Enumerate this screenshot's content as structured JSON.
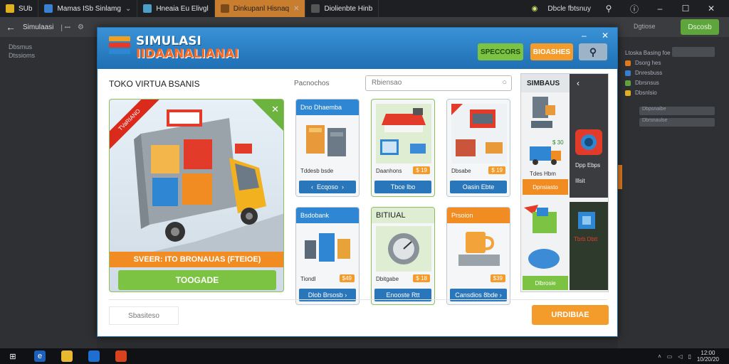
{
  "browser": {
    "tabs": [
      {
        "label": "SUb",
        "color": "#e0b020"
      },
      {
        "label": "Mamas ISb Sinlamg",
        "color": "#3b7fd1"
      },
      {
        "label": "Hneaia Eu Elivgl",
        "color": "#4aa0c8"
      },
      {
        "label": "Dinkupanl Hisnaq",
        "color": "#d28a2a"
      },
      {
        "label": "Diolienbte Hinb",
        "color": "#888888"
      }
    ],
    "right_label": "Dbcle fbtsnuy",
    "toolbar_title": "Simulaasi",
    "toolbar_btn": "Dscosb",
    "toolbar_side": "Dgtiose"
  },
  "left_panel": {
    "line1": "Dbsmus",
    "line2": "Dtssioms"
  },
  "right_panel": {
    "header": "Ltoska Basing foe",
    "rows": [
      "Dsorg hes",
      "Dnresbuss",
      "Dbrsnsus",
      "Dbsnlsio"
    ],
    "bars": [
      "Dbpsnaibe",
      "Dbrsnaulse"
    ]
  },
  "app": {
    "title_line1": "SIMULASI",
    "title_line2": "IIDAANALIANAI",
    "btn_green": "SPECCORS",
    "btn_orange": "BIOASHES",
    "store_name": "TOKO VIRTUA BSANIS",
    "products_label": "Pacnochos",
    "search_placeholder": "Rbiensao",
    "hero": {
      "ribbon": "TVaRIANO",
      "strip": "SVEER: ITO BRONAUAS (FTEIOE)",
      "cta": "TOOGADE"
    },
    "cards": [
      {
        "title": "Dno Dhaemba",
        "name": "Tddesb bsde",
        "price": "",
        "button": "Ecqoso",
        "head": "#2f87d3",
        "btn": "#2a76bb"
      },
      {
        "title": "",
        "name": "Daanhons",
        "price": "$ 19",
        "button": "Tbce lbo",
        "head": "#7cc343",
        "btn": "#2a76bb"
      },
      {
        "title": "",
        "name": "Dbsabe",
        "price": "$ 19",
        "button": "Oasin Ebte",
        "head": "#f08c22",
        "btn": "#2a76bb"
      },
      {
        "title": "Bsdobank",
        "name": "Tiondl",
        "price": "$49",
        "button": "Dlob Brsosb",
        "head": "#2f87d3",
        "btn": "#2a76bb"
      },
      {
        "title": "BITIUAL",
        "name": "Dbitgabe",
        "price": "$ 18",
        "button": "Enooste Rtt",
        "head": "#7cc343",
        "btn": "#2a76bb"
      },
      {
        "title": "Prsoion",
        "name": "",
        "price": "$39",
        "button": "Cansdios 8bde",
        "head": "#f08c22",
        "btn": "#2a76bb"
      }
    ],
    "side_panel": {
      "title": "SIMBAUS",
      "price1": "$ 30",
      "label1": "Tdes Hbm",
      "btn1": "Dpnsiasto",
      "label2": "Tbrb Dbtt",
      "btn2": "Dlbrosie",
      "dark_text1": "Dpp Ebps",
      "dark_text2": "Illsit"
    },
    "footer_left": "Sbasiteso",
    "footer_right": "URDIBIAE"
  },
  "taskbar": {
    "time": "12:00",
    "date": "10/20/20"
  }
}
